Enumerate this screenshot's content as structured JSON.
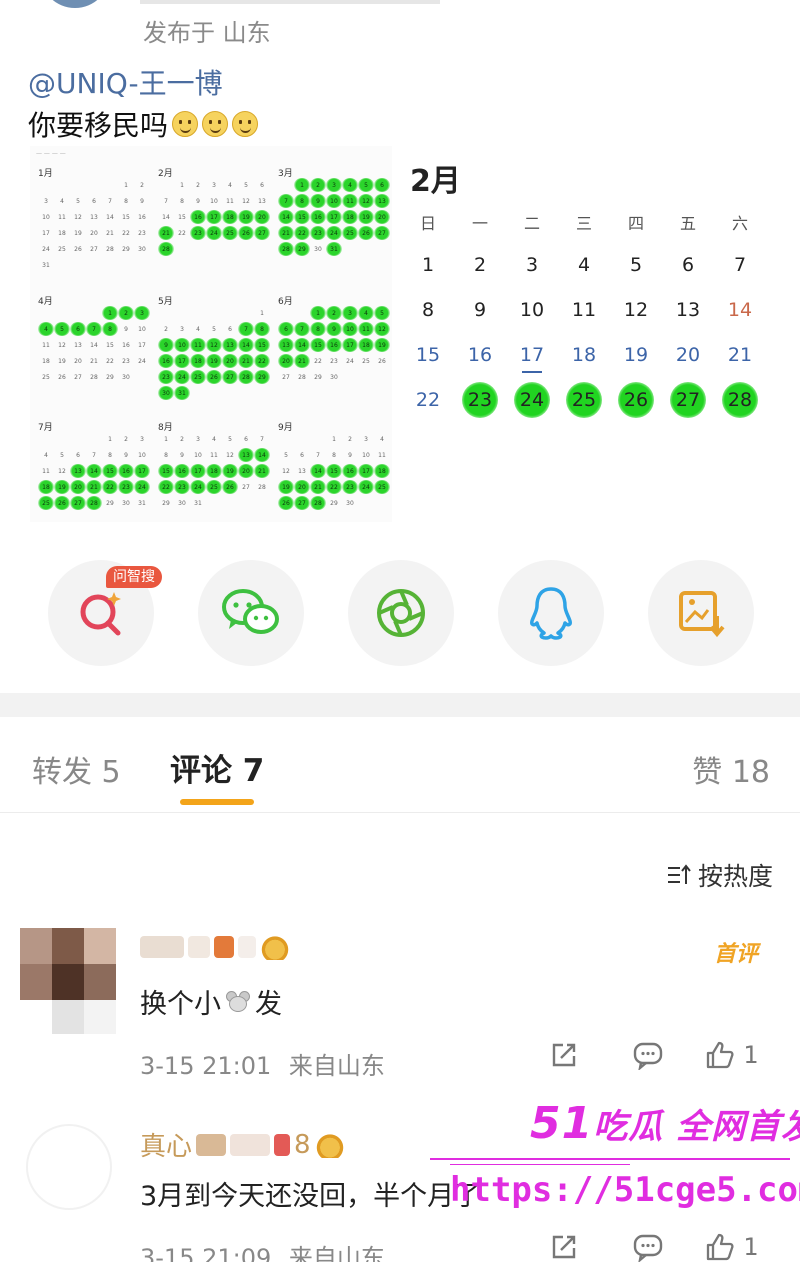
{
  "post": {
    "location": "发布于 山东",
    "mention": "@UNIQ-王一博",
    "text": "你要移民吗"
  },
  "year_calendar": {
    "months": [
      {
        "label": "1月",
        "start": 5,
        "days": 31,
        "green": []
      },
      {
        "label": "2月",
        "start": 1,
        "days": 28,
        "green": [
          16,
          17,
          18,
          19,
          20,
          21,
          23,
          24,
          25,
          26,
          27,
          28
        ]
      },
      {
        "label": "3月",
        "start": 1,
        "days": 31,
        "green": [
          1,
          2,
          3,
          4,
          5,
          6,
          7,
          8,
          9,
          10,
          11,
          12,
          13,
          14,
          15,
          16,
          17,
          18,
          19,
          20,
          21,
          22,
          23,
          24,
          25,
          26,
          27,
          28,
          29,
          31
        ]
      },
      {
        "label": "4月",
        "start": 4,
        "days": 30,
        "green": [
          1,
          2,
          3,
          4,
          5,
          6,
          7,
          8
        ]
      },
      {
        "label": "5月",
        "start": 6,
        "days": 31,
        "green": [
          7,
          8,
          9,
          10,
          11,
          12,
          13,
          14,
          15,
          16,
          17,
          18,
          19,
          20,
          21,
          22,
          23,
          24,
          25,
          26,
          27,
          28,
          29,
          30,
          31
        ]
      },
      {
        "label": "6月",
        "start": 2,
        "days": 30,
        "green": [
          1,
          2,
          3,
          4,
          5,
          6,
          7,
          8,
          9,
          10,
          11,
          12,
          13,
          14,
          15,
          16,
          17,
          18,
          19,
          20,
          21
        ]
      },
      {
        "label": "7月",
        "start": 4,
        "days": 31,
        "green": [
          13,
          14,
          15,
          16,
          17,
          18,
          19,
          20,
          21,
          22,
          23,
          24,
          25,
          26,
          27,
          28
        ]
      },
      {
        "label": "8月",
        "start": 0,
        "days": 31,
        "green": [
          13,
          14,
          15,
          16,
          17,
          18,
          19,
          20,
          21,
          22,
          23,
          24,
          25,
          26
        ]
      },
      {
        "label": "9月",
        "start": 3,
        "days": 30,
        "green": [
          14,
          15,
          16,
          17,
          18,
          19,
          20,
          21,
          22,
          23,
          24,
          25,
          26,
          27,
          28
        ]
      }
    ]
  },
  "feb_calendar": {
    "title": "2月",
    "weekdays": [
      "日",
      "一",
      "二",
      "三",
      "四",
      "五",
      "六"
    ],
    "days": [
      "1",
      "2",
      "3",
      "4",
      "5",
      "6",
      "7",
      "8",
      "9",
      "10",
      "11",
      "12",
      "13",
      "14",
      "15",
      "16",
      "17",
      "18",
      "19",
      "20",
      "21",
      "22",
      "23",
      "24",
      "25",
      "26",
      "27",
      "28"
    ],
    "green": [
      "23",
      "24",
      "25",
      "26",
      "27",
      "28"
    ],
    "red": [
      "14",
      "28"
    ],
    "blue": [
      "15",
      "16",
      "17",
      "18",
      "19",
      "20",
      "21",
      "22"
    ],
    "today": "17"
  },
  "share": {
    "badge": "问智搜",
    "icons": [
      "ai-search-icon",
      "wechat-icon",
      "moments-icon",
      "qq-icon",
      "save-image-icon"
    ]
  },
  "tabs": {
    "repost": "转发 5",
    "comments": "评论 7",
    "likes": "赞 18"
  },
  "sort_label": "按热度",
  "comments": [
    {
      "badge": "首评",
      "text_before": "换个小",
      "text_after": "发",
      "time": "3-15 21:01",
      "from": "来自山东",
      "likes": "1"
    },
    {
      "name_prefix": "真心",
      "name_suffix": "8",
      "text": "3月到今天还没回，半个月了",
      "time": "3-15 21:09",
      "from": "来自山东",
      "likes": "1"
    }
  ],
  "watermark": {
    "number": "51",
    "slogan": "吃瓜 全网首发",
    "url": "https://51cge5.com"
  },
  "colors": {
    "accent_tab": "#f3a41a",
    "mention": "#4b6da0",
    "highlight_green": "#21d421",
    "watermark": "#e02de0"
  }
}
